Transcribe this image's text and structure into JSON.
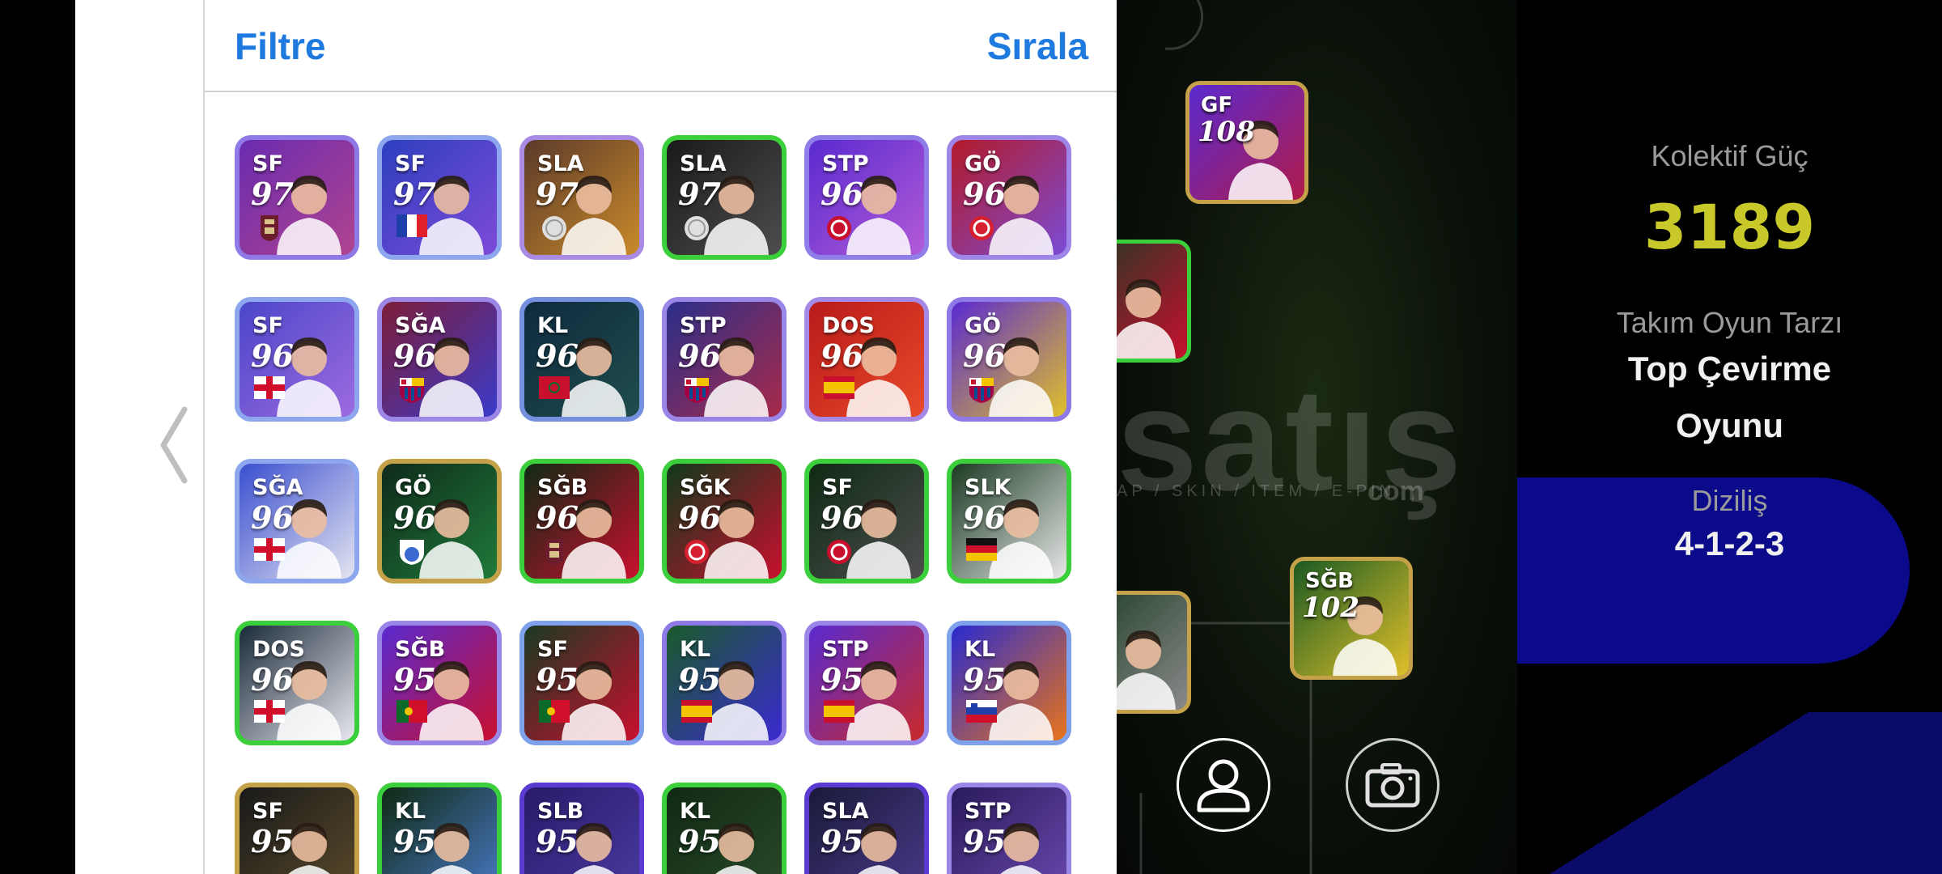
{
  "header": {
    "filter_label": "Filtre",
    "sort_label": "Sırala"
  },
  "colors": {
    "accent": "#1f7ae0",
    "power_value": "#c9c82a",
    "formation_bg": "#0a0a8a"
  },
  "players": [
    {
      "pos": "SF",
      "rating": "97",
      "frame": "#8e79e6",
      "bg": "#6a2bb0",
      "bg2": "#b0448f",
      "emblem": "badge-dark",
      "emblem_color": "#6b1d2e"
    },
    {
      "pos": "SF",
      "rating": "97",
      "frame": "#8ea6ee",
      "bg": "#2d3fbf",
      "bg2": "#7d4bd8",
      "emblem": "flag-fr"
    },
    {
      "pos": "SLA",
      "rating": "97",
      "frame": "#a98be6",
      "bg": "#5b3a2a",
      "bg2": "#c98a2a",
      "emblem": "badge-white",
      "emblem_color": "#dfdfdf"
    },
    {
      "pos": "SLA",
      "rating": "97",
      "frame": "#3ccf3c",
      "bg": "#1a1a1a",
      "bg2": "#4d4d4d",
      "emblem": "badge-white",
      "emblem_color": "#e0e0e0"
    },
    {
      "pos": "STP",
      "rating": "96",
      "frame": "#8f7de8",
      "bg": "#5a2ad0",
      "bg2": "#b25bd6",
      "emblem": "badge-red",
      "emblem_color": "#c8102e"
    },
    {
      "pos": "GÖ",
      "rating": "96",
      "frame": "#9e86e8",
      "bg": "#b31a2a",
      "bg2": "#7b4bd6",
      "emblem": "badge-red",
      "emblem_color": "#d6202f"
    },
    {
      "pos": "SF",
      "rating": "96",
      "frame": "#8ea6ee",
      "bg": "#4b46c9",
      "bg2": "#9d6be0",
      "emblem": "flag-en"
    },
    {
      "pos": "SĞA",
      "rating": "96",
      "frame": "#9c86e6",
      "bg": "#7d1e3a",
      "bg2": "#3b3ac9",
      "emblem": "badge-fcb"
    },
    {
      "pos": "KL",
      "rating": "96",
      "frame": "#7690e0",
      "bg": "#0e2a3e",
      "bg2": "#1f4d4d",
      "emblem": "flag-ma"
    },
    {
      "pos": "STP",
      "rating": "96",
      "frame": "#9a86e6",
      "bg": "#2a2f8a",
      "bg2": "#a82a4a",
      "emblem": "badge-fcb"
    },
    {
      "pos": "DOS",
      "rating": "96",
      "frame": "#a48ae6",
      "bg": "#b81a1a",
      "bg2": "#e84a2a",
      "emblem": "flag-es"
    },
    {
      "pos": "GÖ",
      "rating": "96",
      "frame": "#8e79e6",
      "bg": "#5a2ad0",
      "bg2": "#e0c02a",
      "emblem": "badge-fcb"
    },
    {
      "pos": "SĞA",
      "rating": "96",
      "frame": "#8ea6ee",
      "bg": "#3a4fd0",
      "bg2": "#e4e4f0",
      "emblem": "flag-en"
    },
    {
      "pos": "GÖ",
      "rating": "96",
      "frame": "#c5a24a",
      "bg": "#0f2a1a",
      "bg2": "#1f7a3a",
      "emblem": "badge-blue",
      "emblem_color": "#3a6ad0"
    },
    {
      "pos": "SĞB",
      "rating": "96",
      "frame": "#3ccf3c",
      "bg": "#0f2a14",
      "bg2": "#c8102e",
      "emblem": "badge-dark",
      "emblem_color": "#6b1d2e"
    },
    {
      "pos": "SĞK",
      "rating": "96",
      "frame": "#3ccf3c",
      "bg": "#0f3a1a",
      "bg2": "#c8102e",
      "emblem": "badge-red",
      "emblem_color": "#d6202f"
    },
    {
      "pos": "SF",
      "rating": "96",
      "frame": "#3ccf3c",
      "bg": "#0f2a14",
      "bg2": "#4d4d4d",
      "emblem": "badge-red",
      "emblem_color": "#c8102e"
    },
    {
      "pos": "SLK",
      "rating": "96",
      "frame": "#3ccf3c",
      "bg": "#1a3a22",
      "bg2": "#e8e8e8",
      "emblem": "flag-de"
    },
    {
      "pos": "DOS",
      "rating": "96",
      "frame": "#3ccf3c",
      "bg": "#1a2a3a",
      "bg2": "#e8e8ee",
      "emblem": "flag-en"
    },
    {
      "pos": "SĞB",
      "rating": "95",
      "frame": "#9a86e6",
      "bg": "#5a2ad0",
      "bg2": "#c8102e",
      "emblem": "flag-pt"
    },
    {
      "pos": "SF",
      "rating": "95",
      "frame": "#7fa0ea",
      "bg": "#1a3a22",
      "bg2": "#c8102e",
      "emblem": "flag-pt"
    },
    {
      "pos": "KL",
      "rating": "95",
      "frame": "#8e79e6",
      "bg": "#1a5a2a",
      "bg2": "#3a2ad0",
      "emblem": "flag-es"
    },
    {
      "pos": "STP",
      "rating": "95",
      "frame": "#9a86e6",
      "bg": "#5a2ad0",
      "bg2": "#c82a2a",
      "emblem": "flag-es"
    },
    {
      "pos": "KL",
      "rating": "95",
      "frame": "#7fa0ea",
      "bg": "#2a2ad0",
      "bg2": "#e8741a",
      "emblem": "flag-si"
    },
    {
      "pos": "SF",
      "rating": "95",
      "frame": "#c5a24a",
      "bg": "#1a1a1a",
      "bg2": "#5a4a2a",
      "emblem": "none"
    },
    {
      "pos": "KL",
      "rating": "95",
      "frame": "#3ccf3c",
      "bg": "#0f2a14",
      "bg2": "#4a7ac8",
      "emblem": "none"
    },
    {
      "pos": "SLB",
      "rating": "95",
      "frame": "#5a3ad0",
      "bg": "#2a1a6a",
      "bg2": "#4a3aa0",
      "emblem": "none"
    },
    {
      "pos": "KL",
      "rating": "95",
      "frame": "#3ccf3c",
      "bg": "#0f2a14",
      "bg2": "#2a4a2a",
      "emblem": "none"
    },
    {
      "pos": "SLA",
      "rating": "95",
      "frame": "#5a3ad0",
      "bg": "#1a1a3a",
      "bg2": "#4a3a8a",
      "emblem": "none"
    },
    {
      "pos": "STP",
      "rating": "95",
      "frame": "#9a86e6",
      "bg": "#2a1a5a",
      "bg2": "#6a4ab0",
      "emblem": "none"
    }
  ],
  "pitch": {
    "cards": [
      {
        "pos": "GF",
        "rating": "108",
        "frame": "#c5a24a",
        "bg": "#5a2ad0",
        "bg2": "#b01a4a"
      },
      {
        "pos": "",
        "rating": "",
        "frame": "#3ccf3c",
        "bg": "#1a3a22",
        "bg2": "#c8102e"
      },
      {
        "pos": "",
        "rating": "",
        "frame": "#c5a24a",
        "bg": "#1a3a22",
        "bg2": "#8a8a8a"
      },
      {
        "pos": "SĞB",
        "rating": "102",
        "frame": "#c5a24a",
        "bg": "#1a5a22",
        "bg2": "#e0c02a"
      }
    ],
    "watermark": "satış",
    "watermark_sub": "AP / SKIN / ITEM / E-PIN",
    "watermark_com": "com"
  },
  "side_panel": {
    "power_label": "Kolektif Güç",
    "power_value": "3189",
    "style_label": "Takım Oyun Tarzı",
    "style_value_line1": "Top Çevirme",
    "style_value_line2": "Oyunu",
    "formation_label": "Diziliş",
    "formation_value": "4-1-2-3"
  }
}
